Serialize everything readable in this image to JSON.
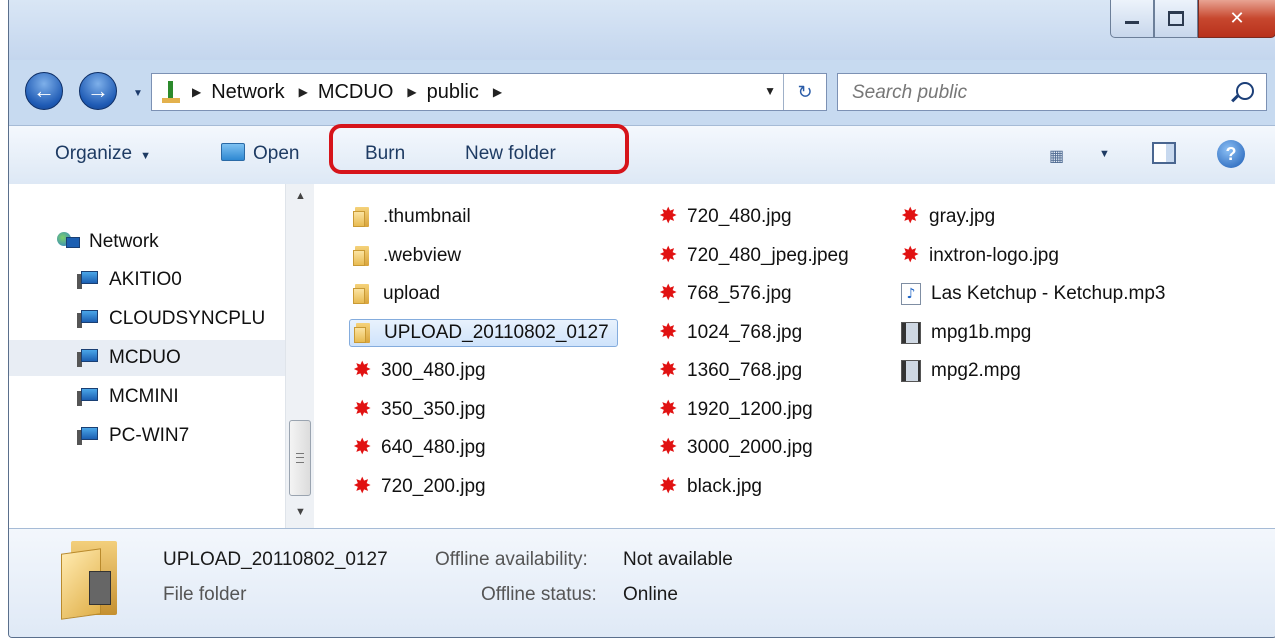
{
  "window": {
    "title": ""
  },
  "address_bar": {
    "path": [
      "Network",
      "MCDUO",
      "public"
    ]
  },
  "search": {
    "placeholder": "Search public"
  },
  "toolbar": {
    "organize": "Organize",
    "open": "Open",
    "burn": "Burn",
    "new_folder": "New folder"
  },
  "nav_pane": {
    "root": "Network",
    "items": [
      {
        "label": "AKITIO0",
        "selected": false
      },
      {
        "label": "CLOUDSYNCPLU",
        "selected": false
      },
      {
        "label": "MCDUO",
        "selected": true
      },
      {
        "label": "MCMINI",
        "selected": false
      },
      {
        "label": "PC-WIN7",
        "selected": false
      }
    ]
  },
  "files": {
    "col1": [
      {
        "name": ".thumbnail",
        "type": "folder"
      },
      {
        "name": ".webview",
        "type": "folder"
      },
      {
        "name": "upload",
        "type": "folder"
      },
      {
        "name": "UPLOAD_20110802_0127",
        "type": "folder",
        "selected": true
      },
      {
        "name": "300_480.jpg",
        "type": "jpg"
      },
      {
        "name": "350_350.jpg",
        "type": "jpg"
      },
      {
        "name": "640_480.jpg",
        "type": "jpg"
      },
      {
        "name": "720_200.jpg",
        "type": "jpg"
      }
    ],
    "col2": [
      {
        "name": "720_480.jpg",
        "type": "jpg"
      },
      {
        "name": "720_480_jpeg.jpeg",
        "type": "jpg"
      },
      {
        "name": "768_576.jpg",
        "type": "jpg"
      },
      {
        "name": "1024_768.jpg",
        "type": "jpg"
      },
      {
        "name": "1360_768.jpg",
        "type": "jpg"
      },
      {
        "name": "1920_1200.jpg",
        "type": "jpg"
      },
      {
        "name": "3000_2000.jpg",
        "type": "jpg"
      },
      {
        "name": "black.jpg",
        "type": "jpg"
      }
    ],
    "col3": [
      {
        "name": "gray.jpg",
        "type": "jpg"
      },
      {
        "name": "inxtron-logo.jpg",
        "type": "jpg"
      },
      {
        "name": "Las Ketchup - Ketchup.mp3",
        "type": "mp3"
      },
      {
        "name": "mpg1b.mpg",
        "type": "mpg"
      },
      {
        "name": "mpg2.mpg",
        "type": "mpg"
      }
    ]
  },
  "details": {
    "name": "UPLOAD_20110802_0127",
    "type": "File folder",
    "availability_label": "Offline availability:",
    "availability_value": "Not available",
    "status_label": "Offline status:",
    "status_value": "Online"
  },
  "colors": {
    "highlight": "#d6141a",
    "accent": "#1e5ab4"
  }
}
